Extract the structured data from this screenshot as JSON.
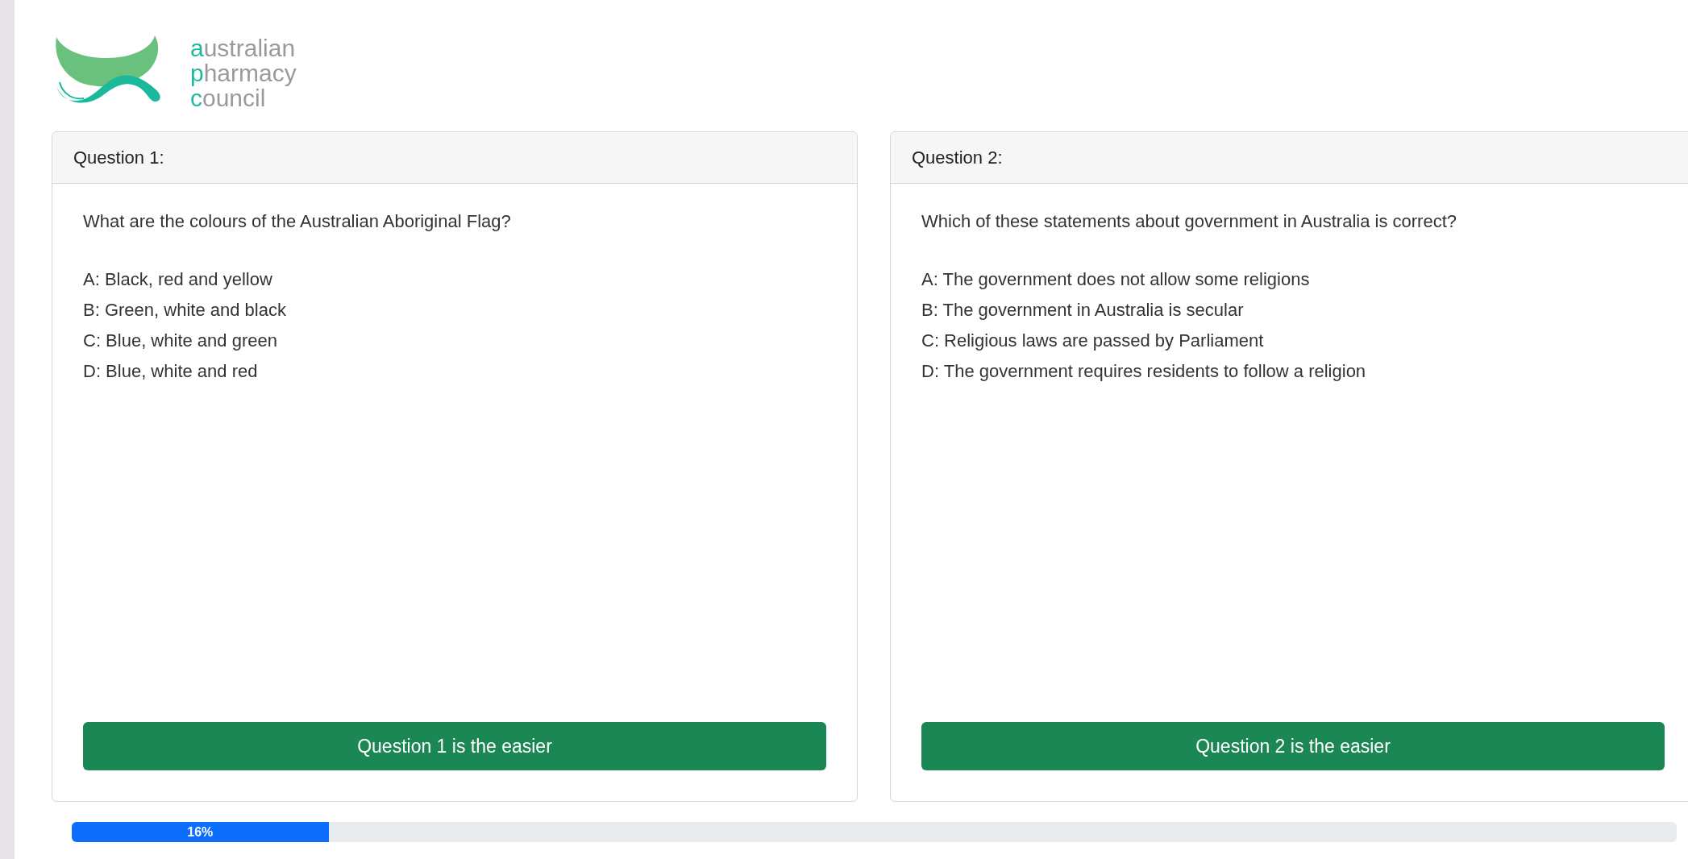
{
  "logo": {
    "lines": [
      "australian",
      "pharmacy",
      "council"
    ]
  },
  "questions": [
    {
      "header": "Question 1:",
      "prompt": "What are the colours of the Australian Aboriginal Flag?",
      "options": [
        "A: Black, red and yellow",
        "B: Green, white and black",
        "C: Blue, white and green",
        "D: Blue, white and red"
      ],
      "button": "Question 1 is the easier"
    },
    {
      "header": "Question 2:",
      "prompt": "Which of these statements about government in Australia is correct?",
      "options": [
        "A: The government does not allow some religions",
        "B: The government in Australia is secular",
        "C: Religious laws are passed by Parliament",
        "D: The government requires residents to follow a religion"
      ],
      "button": "Question 2 is the easier"
    }
  ],
  "progress": {
    "level": 0.16,
    "label": "16%"
  }
}
